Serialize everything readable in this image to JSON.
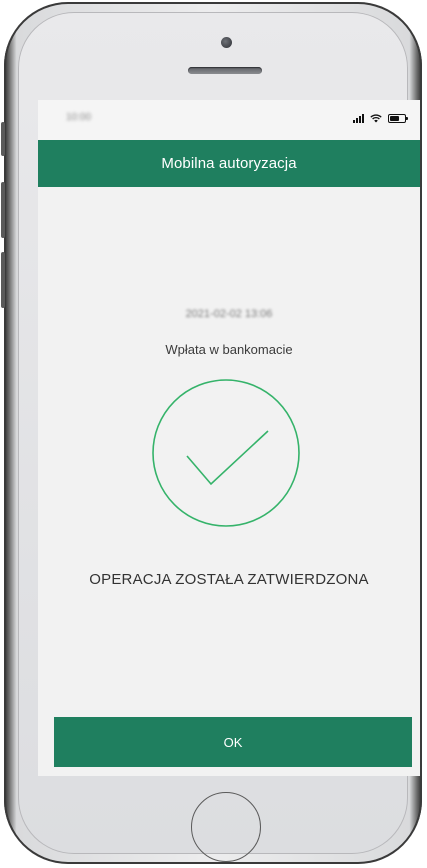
{
  "colors": {
    "brand": "#1f7f5f",
    "check_stroke": "#35b36a"
  },
  "status_bar": {
    "time": "10:00",
    "icons": [
      "signal-icon",
      "wifi-icon",
      "battery-icon"
    ]
  },
  "header": {
    "title": "Mobilna autoryzacja"
  },
  "operation": {
    "datetime": "2021-02-02 13:06",
    "name": "Wpłata w bankomacie",
    "status_icon": "checkmark-circle-icon",
    "confirmation": "OPERACJA ZOSTAŁA ZATWIERDZONA"
  },
  "actions": {
    "ok_label": "OK"
  },
  "device": {
    "icons": [
      "front-camera-icon",
      "earpiece-speaker-icon",
      "home-button-icon"
    ]
  }
}
